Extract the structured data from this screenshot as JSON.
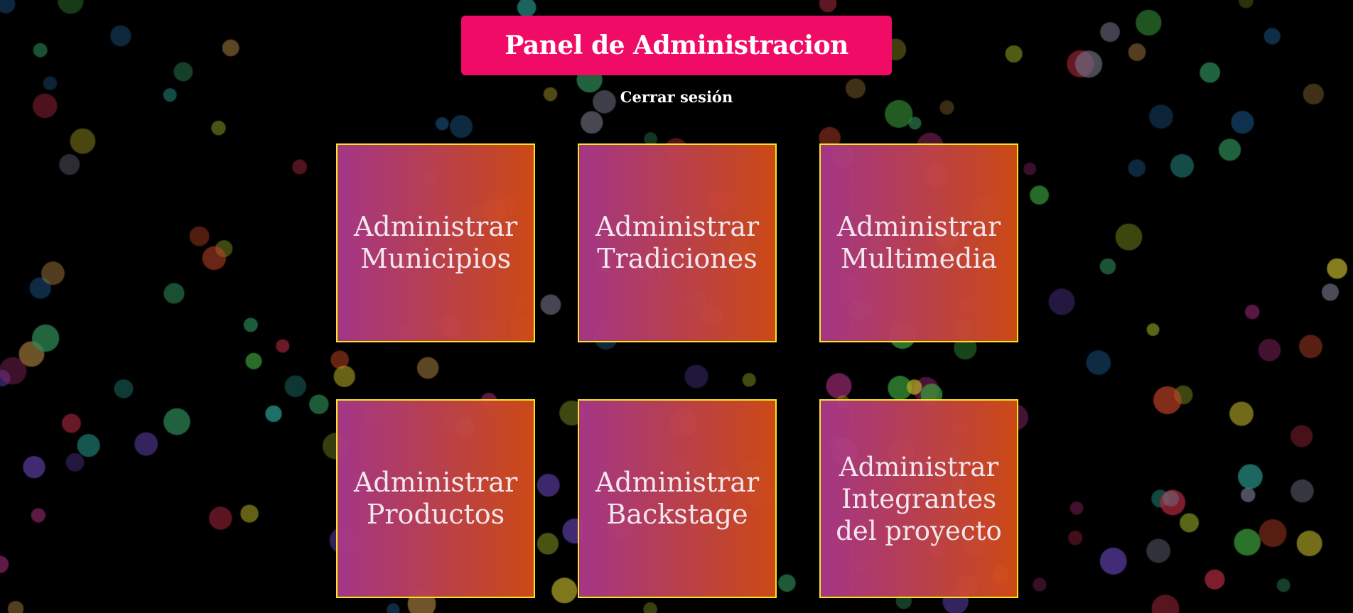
{
  "header": {
    "title": "Panel de Administracion",
    "logout_label": "Cerrar sesión"
  },
  "cards": [
    {
      "label": "Administrar Municipios"
    },
    {
      "label": "Administrar Tradiciones"
    },
    {
      "label": "Administrar Multimedia"
    },
    {
      "label": "Administrar Productos"
    },
    {
      "label": "Administrar Backstage"
    },
    {
      "label": "Administrar Integrantes del proyecto"
    }
  ],
  "colors": {
    "page_background": "#000000",
    "title_banner": "#f00b66",
    "card_gradient_start": "#aa388c",
    "card_gradient_end": "#d44c16",
    "card_border": "#f7e81e",
    "text": "#ffffff"
  }
}
